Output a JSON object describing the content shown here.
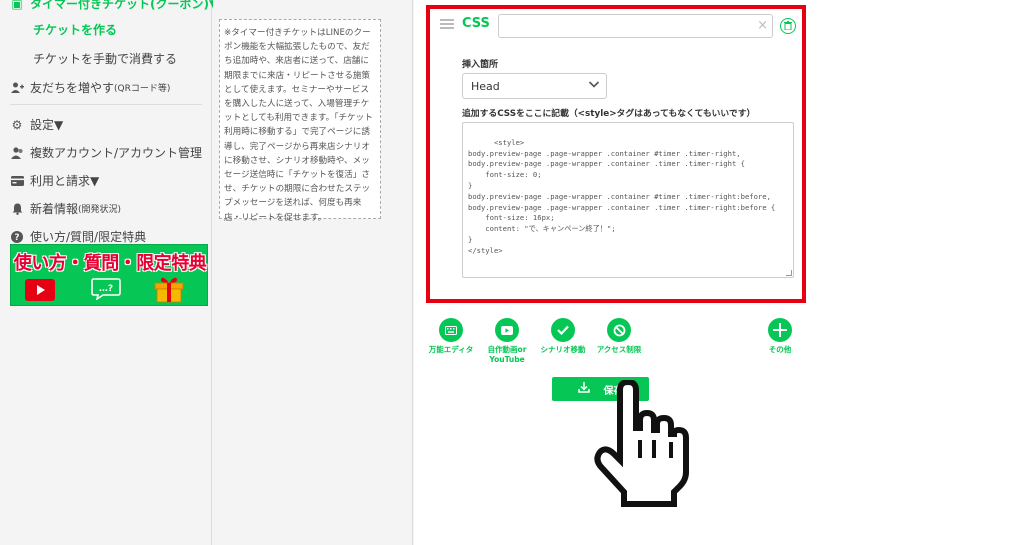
{
  "sidebar": {
    "timer_ticket": "タイマー付きチケット(クーポン)▼",
    "create_ticket": "チケットを作る",
    "consume_ticket": "チケットを手動で消費する",
    "add_friends": "友だちを増やす",
    "add_friends_suffix": "(QRコード等)",
    "settings": "設定▼",
    "multi_account": "複数アカウント/アカウント管理",
    "billing": "利用と請求▼",
    "news": "新着情報",
    "news_suffix": "(開発状況)",
    "help": "使い方/質問/限定特典",
    "banner_title": "使い方・質問・限定特典"
  },
  "note": "※タイマー付きチケットはLINEのクーポン機能を大幅拡張したもので、友だち追加時や、来店者に送って、店舗に期限までに来店・リピートさせる施策として使えます。セミナーやサービスを購入した人に送って、入場管理チケットとしても利用できます。「チケット利用時に移動する」で完了ページに誘導し、完了ページから再来店シナリオに移動させ、シナリオ移動時や、メッセージ送信時に「チケットを復活」させ、チケットの期限に合わせたステップメッセージを送れば、何度も再来店・リピートを促せます。",
  "css_card": {
    "title": "CSS",
    "insert_label": "挿入箇所",
    "insert_value": "Head",
    "code_label": "追加するCSSをここに記載（<style>タグはあってもなくてもいいです）",
    "code": "<style>\nbody.preview-page .page-wrapper .container #timer .timer-right,\nbody.preview-page .page-wrapper .container .timer .timer-right {\n    font-size: 0;\n}\nbody.preview-page .page-wrapper .container #timer .timer-right:before,\nbody.preview-page .page-wrapper .container .timer .timer-right:before {\n    font-size: 16px;\n    content: \"で、キャンペーン終了！\";\n}\n</style>"
  },
  "toolbar": {
    "universal_editor": "万能エディタ",
    "video_line1": "自作動画or",
    "video_line2": "YouTube",
    "scenario_move": "シナリオ移動",
    "access_limit": "アクセス制限",
    "other": "その他",
    "save": "保存"
  }
}
